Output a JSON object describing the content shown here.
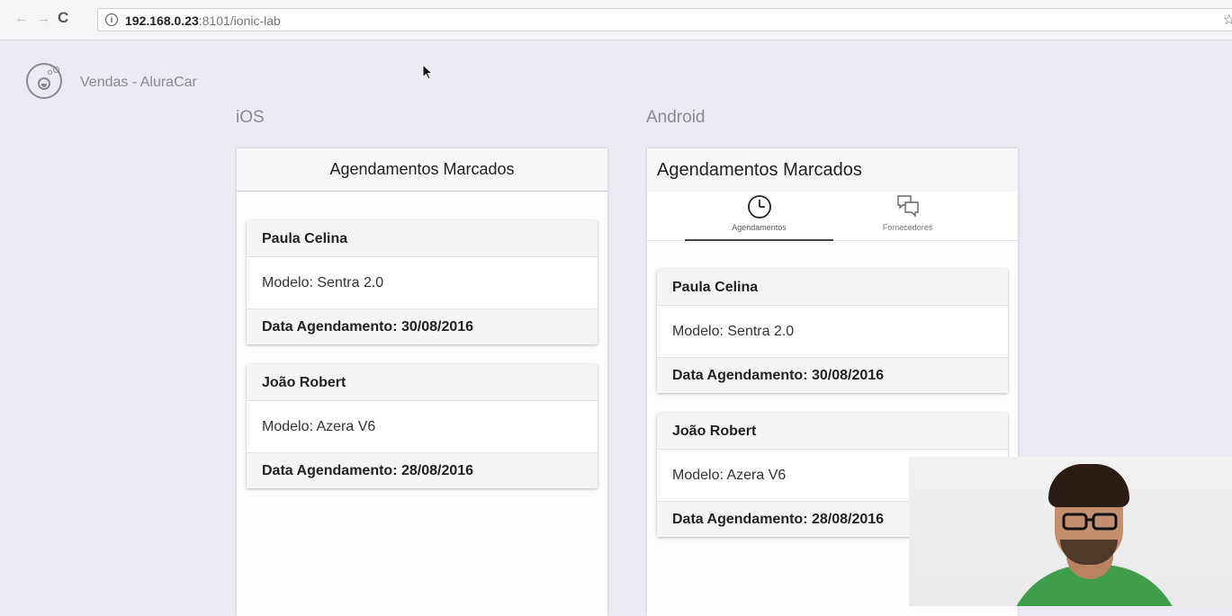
{
  "browser": {
    "back_glyph": "←",
    "forward_glyph": "→",
    "reload_glyph": "C",
    "info_glyph": "i",
    "url_host": "192.168.0.23",
    "url_rest": ":8101/ionic-lab",
    "star_glyph": "☆"
  },
  "lab": {
    "title": "Vendas - AluraCar",
    "platform_ios": "iOS",
    "platform_android": "Android"
  },
  "ios": {
    "page_title": "Agendamentos Marcados",
    "cards": [
      {
        "name": "Paula Celina",
        "model": "Modelo: Sentra 2.0",
        "date": "Data Agendamento: 30/08/2016"
      },
      {
        "name": "João Robert",
        "model": "Modelo: Azera V6",
        "date": "Data Agendamento: 28/08/2016"
      }
    ]
  },
  "android": {
    "page_title": "Agendamentos Marcados",
    "tabs": [
      {
        "label": "Agendamentos",
        "icon": "clock-icon",
        "selected": true
      },
      {
        "label": "Fornecedores",
        "icon": "chat-bubbles-icon",
        "selected": false
      }
    ],
    "cards": [
      {
        "name": "Paula Celina",
        "model": "Modelo: Sentra 2.0",
        "date": "Data Agendamento: 30/08/2016"
      },
      {
        "name": "João Robert",
        "model": "Modelo: Azera V6",
        "date": "Data Agendamento: 28/08/2016"
      }
    ]
  },
  "colors": {
    "page_bg": "#eaeaf3",
    "card_header_bg": "#f5f5f7",
    "webcam_shirt": "#3f9e4c"
  }
}
